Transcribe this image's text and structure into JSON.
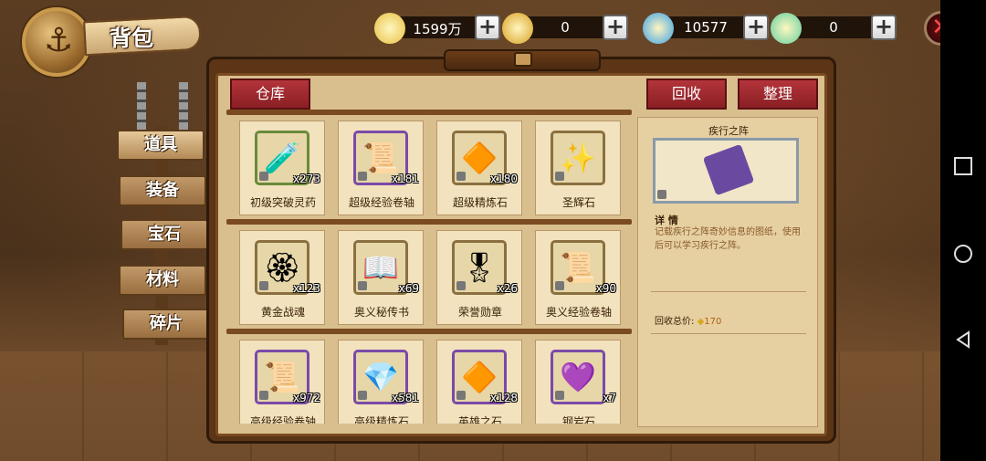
{
  "title": "背包",
  "currencies": [
    {
      "name": "gold",
      "value": "1599万"
    },
    {
      "name": "coin",
      "value": "0"
    },
    {
      "name": "diamond",
      "value": "10577"
    },
    {
      "name": "gem",
      "value": "0"
    }
  ],
  "sidebar": {
    "items": [
      {
        "label": "道具",
        "active": true
      },
      {
        "label": "装备",
        "active": false
      },
      {
        "label": "宝石",
        "active": false
      },
      {
        "label": "材料",
        "active": false
      },
      {
        "label": "碎片",
        "active": false
      }
    ]
  },
  "tabs": {
    "warehouse": "仓库",
    "recycle": "回收",
    "sort": "整理"
  },
  "items": [
    {
      "name": "初级突破灵药",
      "qty": "x273",
      "glyph": "🧪",
      "border": "green"
    },
    {
      "name": "超级经验卷轴",
      "qty": "x181",
      "glyph": "📜",
      "border": "purple"
    },
    {
      "name": "超级精炼石",
      "qty": "x180",
      "glyph": "🔶",
      "border": "gold"
    },
    {
      "name": "圣辉石",
      "qty": "",
      "glyph": "✨",
      "border": "gold"
    },
    {
      "name": "黄金战魂",
      "qty": "x123",
      "glyph": "🏵",
      "border": "gold"
    },
    {
      "name": "奥义秘传书",
      "qty": "x69",
      "glyph": "📖",
      "border": "gold"
    },
    {
      "name": "荣誉勋章",
      "qty": "x26",
      "glyph": "🎖",
      "border": "gold"
    },
    {
      "name": "奥义经验卷轴",
      "qty": "x90",
      "glyph": "📜",
      "border": "gold"
    },
    {
      "name": "高级经验卷轴",
      "qty": "x972",
      "glyph": "📜",
      "border": "purple"
    },
    {
      "name": "高级精炼石",
      "qty": "x581",
      "glyph": "💎",
      "border": "purple"
    },
    {
      "name": "英雄之石",
      "qty": "x128",
      "glyph": "🔶",
      "border": "purple"
    },
    {
      "name": "钢岩石",
      "qty": "x7",
      "glyph": "💜",
      "border": "purple"
    }
  ],
  "detail": {
    "title": "疾行之阵",
    "section": "详 情",
    "description": "记载疾行之阵奇妙信息的图纸，使用后可以学习疾行之阵。",
    "recycle_label": "回收总价:",
    "recycle_value": "170"
  },
  "colors": {
    "accent_red": "#b3343a",
    "panel": "#d9bf8e",
    "frame": "#5c3416"
  }
}
